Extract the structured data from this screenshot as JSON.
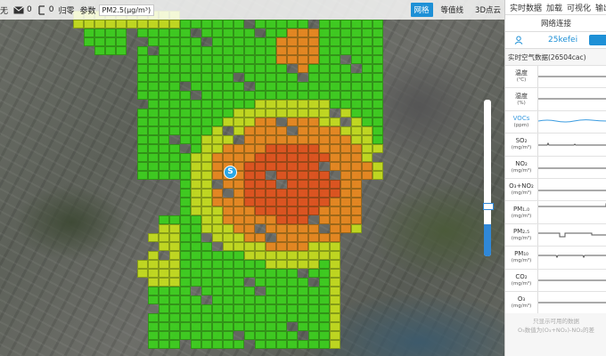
{
  "toolbar": {
    "item1_label": "无",
    "item2_value": "0",
    "item3_value": "0",
    "item3_label": "归零",
    "param_label": "参数",
    "param_value": "PM2.5(μg/m³)",
    "tabs": [
      "网格",
      "等值线",
      "3D点云"
    ],
    "active_tab": "网格"
  },
  "marker": {
    "label": "S"
  },
  "panel": {
    "menu": [
      "实时数据",
      "加载",
      "可视化",
      "输出"
    ],
    "subtitle": "网络连接",
    "user_name": "25kefei",
    "realtime_title": "实时空气数据(26504cac)",
    "sensors": [
      {
        "name": "温度",
        "unit": "(℃)"
      },
      {
        "name": "湿度",
        "unit": "(%)"
      },
      {
        "name": "VOCs",
        "unit": "(ppm)"
      },
      {
        "name": "SO₂",
        "unit": "(mg/m³)"
      },
      {
        "name": "NO₂",
        "unit": "(mg/m³)"
      },
      {
        "name": "O₃+NO₂",
        "unit": "(mg/m³)"
      },
      {
        "name": "PM₁.₀",
        "unit": "(mg/m³)"
      },
      {
        "name": "PM₂.₅",
        "unit": "(mg/m³)"
      },
      {
        "name": "PM₁₀",
        "unit": "(mg/m³)"
      },
      {
        "name": "CO₂",
        "unit": "(mg/m³)"
      },
      {
        "name": "O₃",
        "unit": "(mg/m³)"
      }
    ],
    "footer_line1": "只显示可用的数据",
    "footer_line2": "O₃数值为(O₃+NO₂)-NO₂的差"
  },
  "colors": {
    "accent": "#1e90d6",
    "grid_green": "#3bd41b",
    "grid_yellow": "#c9e21b",
    "grid_orange": "#f08a1c",
    "grid_red": "#e8521a"
  }
}
